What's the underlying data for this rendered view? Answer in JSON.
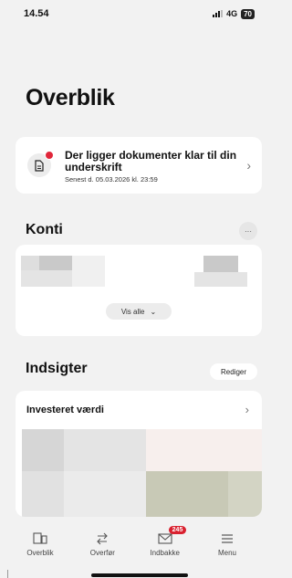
{
  "status_bar": {
    "time": "14.54",
    "network": "4G",
    "battery": "70"
  },
  "page": {
    "title": "Overblik"
  },
  "notice": {
    "title": "Der ligger dokumenter klar til din underskrift",
    "subtitle": "Senest d. 05.03.2026 kl. 23:59",
    "icon": "document-icon"
  },
  "accounts": {
    "title": "Konti",
    "more_label": "···",
    "show_all_label": "Vis alle",
    "colors": {
      "blur_dark": "#c9c9c9",
      "blur_mid": "#dedede",
      "blur_light": "#ececec"
    }
  },
  "insights": {
    "title": "Indsigter",
    "edit_label": "Rediger",
    "card_title": "Investeret værdi",
    "colors": {
      "blur_a": "#d6d6d6",
      "blur_b": "#e4e4e4",
      "blur_pink": "#f7efed",
      "blur_olive": "#c8c9b6"
    }
  },
  "tab_bar": {
    "items": [
      {
        "label": "Overblik",
        "icon": "overview-icon"
      },
      {
        "label": "Overfør",
        "icon": "transfer-icon"
      },
      {
        "label": "Indbakke",
        "icon": "inbox-icon",
        "badge": "245"
      },
      {
        "label": "Menu",
        "icon": "menu-icon"
      }
    ]
  },
  "colors": {
    "accent_red": "#d9212f",
    "background": "#f2f2f2"
  }
}
